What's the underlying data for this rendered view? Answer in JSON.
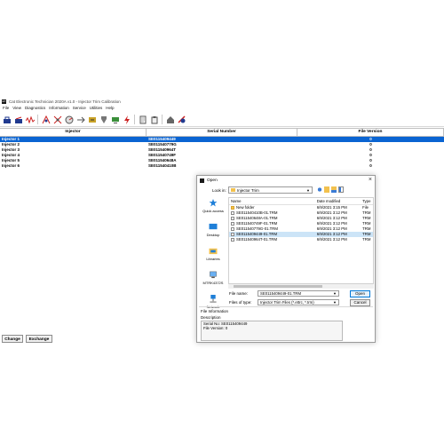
{
  "app": {
    "title": "Cat Electronic Technician 2020A v1.0 - Injector Trim Calibration",
    "menu": [
      "File",
      "View",
      "Diagnostics",
      "Information",
      "Service",
      "Utilities",
      "Help"
    ],
    "table": {
      "headers": [
        "Injector",
        "Serial Number",
        "File Version"
      ],
      "rows": [
        {
          "injector": "Injector 1",
          "serial": "SE0115409449",
          "version": "0"
        },
        {
          "injector": "Injector 2",
          "serial": "SE011540779G",
          "version": "0"
        },
        {
          "injector": "Injector 3",
          "serial": "SE011540964T",
          "version": "0"
        },
        {
          "injector": "Injector 4",
          "serial": "SE011540749F",
          "version": "0"
        },
        {
          "injector": "Injector 5",
          "serial": "SE011540648A",
          "version": "0"
        },
        {
          "injector": "Injector 6",
          "serial": "SE011540410B",
          "version": "0"
        }
      ]
    },
    "buttons": {
      "change": "Change",
      "exchange": "Exchange"
    }
  },
  "dialog": {
    "title": "Open",
    "close": "×",
    "look_in_label": "Look in:",
    "look_in_value": "Injector Trim",
    "places": [
      "Quick access",
      "Desktop",
      "Libraries",
      "MTRK4372S",
      "Network"
    ],
    "columns": [
      "Name",
      "Date modified",
      "Type"
    ],
    "files": [
      {
        "name": "New folder",
        "date": "6/9/2021 3:15 PM",
        "type": "File"
      },
      {
        "name": "SE011540410B-01.TRM",
        "date": "6/9/2021 3:12 PM",
        "type": "TRM"
      },
      {
        "name": "SE011540648A-01.TRM",
        "date": "6/9/2021 3:12 PM",
        "type": "TRM"
      },
      {
        "name": "SE011540749F-01.TRM",
        "date": "6/9/2021 3:12 PM",
        "type": "TRM"
      },
      {
        "name": "SE011540779G-01.TRM",
        "date": "6/9/2021 3:12 PM",
        "type": "TRM"
      },
      {
        "name": "SE0115409449-01.TRM",
        "date": "6/9/2021 3:12 PM",
        "type": "TRM"
      },
      {
        "name": "SE011540964T-01.TRM",
        "date": "6/9/2021 3:12 PM",
        "type": "TRM"
      }
    ],
    "file_name_label": "File name:",
    "file_name_value": "SE0115409449-01.TRM",
    "file_type_label": "Files of type:",
    "file_type_value": "Injector Trim Files (*.ettrc, *.trm)",
    "open_label": "Open",
    "cancel_label": "Cancel",
    "file_info_label": "File Information",
    "description_label": "Description",
    "desc_lines": [
      "Serial No: SE0115409449",
      "File Version: 0"
    ]
  },
  "colors": {
    "selection": "#0a64d2",
    "dialog_selection": "#cce4f7",
    "folder": "#f2c14e"
  }
}
